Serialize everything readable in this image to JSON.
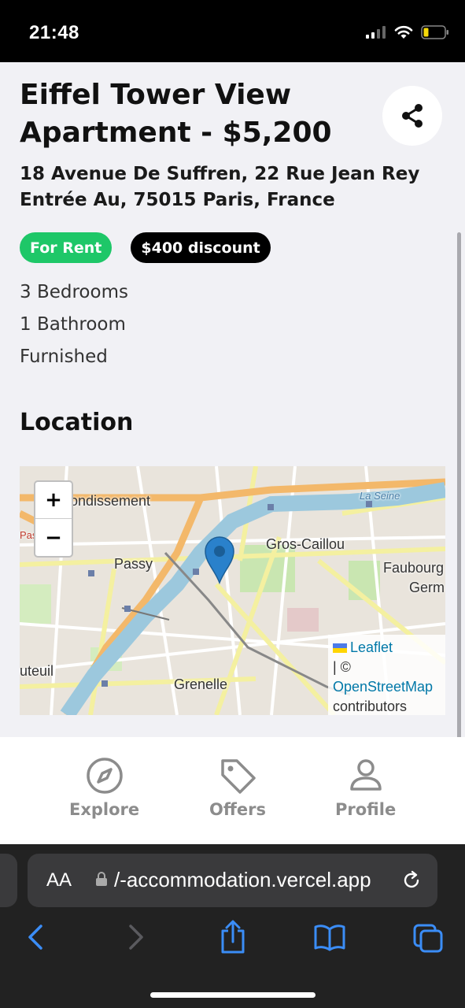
{
  "status_bar": {
    "time": "21:48"
  },
  "listing": {
    "title": "Eiffel Tower View Apartment - $5,200",
    "address": "18 Avenue De Suffren, 22 Rue Jean Rey Entrée Au, 75015 Paris, France",
    "badges": {
      "status": "For Rent",
      "discount": "$400 discount"
    },
    "features": [
      "3 Bedrooms",
      "1 Bathroom",
      "Furnished"
    ],
    "location_heading": "Location"
  },
  "map": {
    "zoom_in": "+",
    "zoom_out": "−",
    "labels": {
      "arrondissement": "rondissement",
      "passy": "Passy",
      "gros_caillou": "Gros-Caillou",
      "faubourg": "Faubourg",
      "germ": "Germ",
      "auteuil": "uteuil",
      "grenelle": "Grenelle",
      "la_seine": "La Seine",
      "pas": "Pas"
    },
    "attribution": {
      "leaflet": "Leaflet",
      "sep": "| ©",
      "osm": "OpenStreetMap",
      "contributors": "contributors"
    },
    "colors": {
      "water": "#9cc8dd",
      "major_road": "#f6c580",
      "road": "#f6f3a8",
      "park": "#c9e6b1"
    }
  },
  "bottom_nav": {
    "explore": "Explore",
    "offers": "Offers",
    "profile": "Profile"
  },
  "browser": {
    "aa": "AA",
    "url": "/-accommodation.vercel.app"
  }
}
